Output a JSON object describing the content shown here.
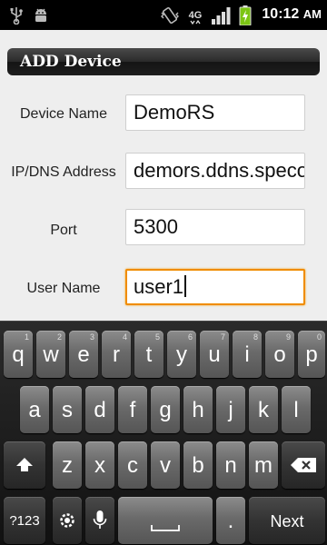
{
  "status_bar": {
    "time": "10:12",
    "ampm": "AM",
    "icons": [
      "usb-icon",
      "android-debug-icon",
      "vibrate-icon",
      "network-4g-icon",
      "signal-icon",
      "battery-charging-icon"
    ],
    "network_label": "4G"
  },
  "screen": {
    "title": "ADD Device",
    "fields": [
      {
        "label": "Device Name",
        "value": "DemoRS"
      },
      {
        "label": "IP/DNS Address",
        "value": "demors.ddns.speco"
      },
      {
        "label": "Port",
        "value": "5300"
      },
      {
        "label": "User Name",
        "value": "user1"
      }
    ]
  },
  "keyboard": {
    "row1": [
      {
        "key": "q",
        "hint": "1"
      },
      {
        "key": "w",
        "hint": "2"
      },
      {
        "key": "e",
        "hint": "3"
      },
      {
        "key": "r",
        "hint": "4"
      },
      {
        "key": "t",
        "hint": "5"
      },
      {
        "key": "y",
        "hint": "6"
      },
      {
        "key": "u",
        "hint": "7"
      },
      {
        "key": "i",
        "hint": "8"
      },
      {
        "key": "o",
        "hint": "9"
      },
      {
        "key": "p",
        "hint": "0"
      }
    ],
    "row2": [
      "a",
      "s",
      "d",
      "f",
      "g",
      "h",
      "j",
      "k",
      "l"
    ],
    "row3": [
      "z",
      "x",
      "c",
      "v",
      "b",
      "n",
      "m"
    ],
    "symbols_label": "?123",
    "period": ".",
    "next_label": "Next"
  },
  "colors": {
    "focus_border": "#f08c00",
    "content_bg": "#eeeeee",
    "battery_green": "#7cc513"
  }
}
